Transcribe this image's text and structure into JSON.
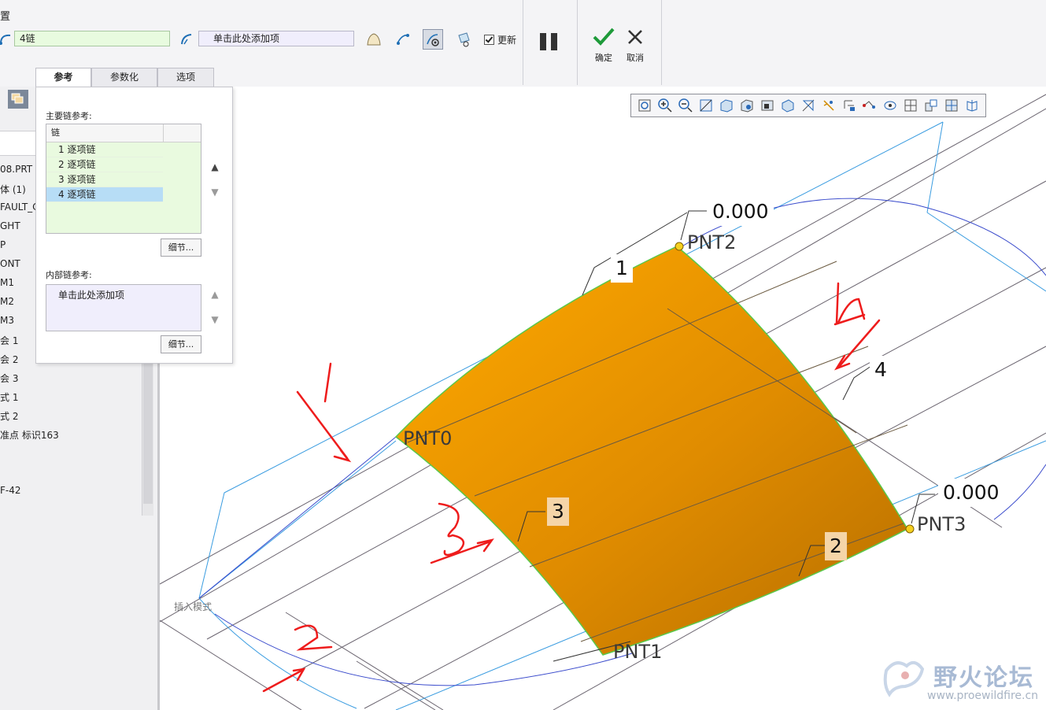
{
  "ribbon": {
    "title": "置",
    "chain_value": "4链",
    "ref_placeholder": "单击此处添加项",
    "update_label": "更新",
    "ok_label": "确定",
    "cancel_label": "取消"
  },
  "tabs": [
    {
      "label": "参考"
    },
    {
      "label": "参数化"
    },
    {
      "label": "选项"
    }
  ],
  "panel": {
    "main_chain_label": "主要链参考:",
    "list_header": "链",
    "chains": [
      "1 逐项链",
      "2 逐项链",
      "3 逐项链",
      "4 逐项链"
    ],
    "selected_index": 3,
    "detail_label": "细节...",
    "inner_chain_label": "内部链参考:",
    "inner_placeholder": "单击此处添加项"
  },
  "tree": {
    "items": [
      "08.PRT",
      "体 (1)",
      "FAULT_C",
      "GHT",
      "P",
      "ONT",
      "M1",
      "M2",
      "M3",
      "会 1",
      "会 2",
      "会 3",
      "式 1",
      "式 2",
      "准点 标识163",
      "F-42"
    ]
  },
  "graphics": {
    "dim_top": "0.000",
    "dim_right": "0.000",
    "pnt0": "PNT0",
    "pnt1": "PNT1",
    "pnt2": "PNT2",
    "pnt3": "PNT3",
    "edge1": "1",
    "edge2": "2",
    "edge3": "3",
    "edge4": "4",
    "insert_mode": "插入模式",
    "surface_color": "#f5a000",
    "curve_color": "#3a9ce0",
    "annotation_color": "#ee1c1c"
  },
  "view_toolbar": {
    "icons": [
      "refit-icon",
      "zoom-in-icon",
      "zoom-out-icon",
      "repaint-icon",
      "display-style-icon",
      "saved-orientation-icon",
      "saved-views-icon",
      "section-icon",
      "datum-display-icon",
      "point-display-icon",
      "csys-display-icon",
      "spin-center-icon",
      "annotation-icon",
      "layer-icon",
      "view-manager-icon",
      "appearance-icon",
      "simulation-icon"
    ]
  },
  "watermark": {
    "title": "野火论坛",
    "url": "www.proewildfire.cn"
  }
}
